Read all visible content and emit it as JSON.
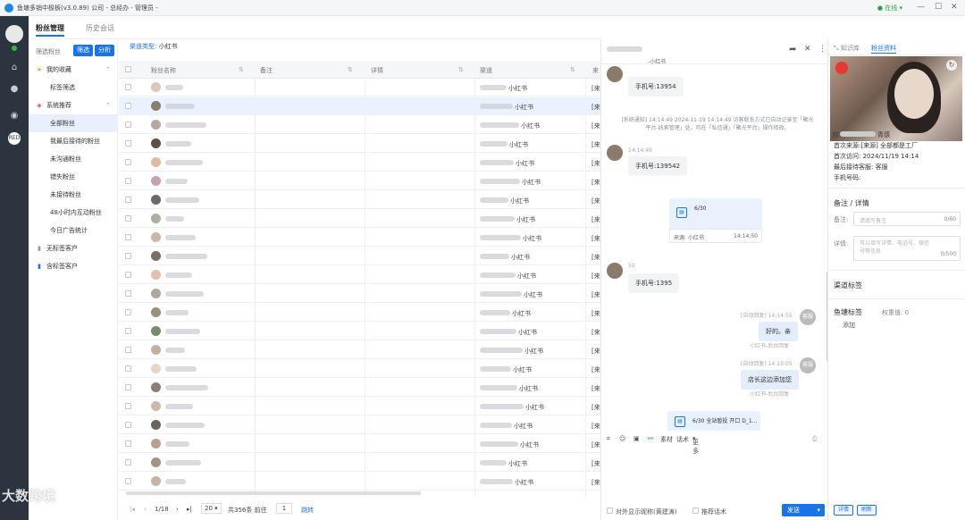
{
  "window": {
    "title": "鱼塘多销中极板(v3.0.89)    公司 - 总经办 - 管理员 -",
    "status": "在线"
  },
  "tabs": [
    "粉丝管理",
    "历史会话"
  ],
  "filter": {
    "label": "筛选粉丝",
    "btn_filter": "筛选",
    "btn_analyze": "分析"
  },
  "nav": {
    "favorites": "我的收藏",
    "tag_filter": "标签筛选",
    "system": "系统推荐",
    "all": "全部粉丝",
    "recent": "我最后接待的粉丝",
    "not_followed": "未沟通粉丝",
    "lost": "错失粉丝",
    "not_received": "未接待粉丝",
    "active48": "48小时内互动粉丝",
    "ad_stats": "今日广告统计",
    "no_tag": "无标签客户",
    "has_tag": "含标签客户"
  },
  "source_type": {
    "label": "渠道类型:",
    "value": "小红书"
  },
  "columns": [
    "粉丝名称",
    "备注",
    "详情",
    "渠道",
    "来"
  ],
  "rows": [
    {
      "channel": "小红书",
      "extra": "[来"
    },
    {
      "channel": "小红书",
      "extra": "[来"
    },
    {
      "channel": "小红书",
      "extra": "[来"
    },
    {
      "channel": "小红书",
      "extra": "[来"
    },
    {
      "channel": "小红书",
      "extra": "[来"
    },
    {
      "channel": "小红书",
      "extra": "[来"
    },
    {
      "channel": "小红书",
      "extra": "[来"
    },
    {
      "channel": "小红书",
      "extra": "[来"
    },
    {
      "channel": "小红书",
      "extra": "[来"
    },
    {
      "channel": "小红书",
      "extra": "[来"
    },
    {
      "channel": "小红书",
      "extra": "[来"
    },
    {
      "channel": "小红书",
      "extra": "[来"
    },
    {
      "channel": "小红书",
      "extra": "[来"
    },
    {
      "channel": "小红书",
      "extra": "[来"
    },
    {
      "channel": "小红书",
      "extra": "[来"
    },
    {
      "channel": "小红书",
      "extra": "[来"
    },
    {
      "channel": "小红书",
      "extra": "[来"
    },
    {
      "channel": "小红书",
      "extra": "[来"
    },
    {
      "channel": "小红书",
      "extra": "[来"
    },
    {
      "channel": "小红书",
      "extra": "[来"
    },
    {
      "channel": "小红书",
      "extra": "[来"
    },
    {
      "channel": "小红书",
      "extra": "[来"
    }
  ],
  "pager": {
    "page": "1/18",
    "size": "20",
    "total": "共356条 前往",
    "goto": "1",
    "jump": "跳转"
  },
  "chat": {
    "header_sub": "-小红书",
    "m1": "手机号:13954",
    "sys": "[系统通知] 14:14:49 2024-11-19 14:14:49 访客联系方式已自动记录至「聚光平台-线索管理」处。可在「私信通」「聚光平台」操作修改。",
    "t2": "14:14:49",
    "m2": "手机号:139542",
    "card_title": "6/30",
    "card_src": "来源: 小红书",
    "card_time": "14:14:50",
    "t3": "50",
    "m3": "手机号:1395",
    "auto1": "[自动回复] 14:14:55",
    "r1": "好的。亲",
    "rfrom1": "小红书-后台回复",
    "ravname": "客服",
    "auto2": "[自动回复] 14:15:05",
    "r2": "店长这边添加您",
    "rfrom2": "小红书-后台回复",
    "card2_title": "6/30 全站暂投 开口 D_1...",
    "tools": [
      "素材",
      "话术",
      "更多"
    ],
    "opt1": "对外显示昵称(黄建涛)",
    "opt2": "推荐话术",
    "send": "发送"
  },
  "profile": {
    "tabs": [
      "知识库",
      "粉丝资料"
    ],
    "name_tail": "青感",
    "first_src_label": "首次来源:",
    "first_src": "[来源]     全部都是工厂",
    "first_visit_label": "首次访问:",
    "first_visit": "2024/11/19 14:14",
    "last_agent_label": "最后接待客服:",
    "last_agent": "客服",
    "phone_label": "手机号码:",
    "notes_title": "备注 / 详情",
    "note_label": "备注:",
    "note_ph": "请填写备注",
    "note_cnt": "0/60",
    "detail_label": "详情:",
    "detail_ph": "可以填写详情、电话号、微信号等信息",
    "detail_cnt": "0/500",
    "channel_tags": "渠道标签",
    "fish_tags": "鱼塘标签",
    "weight": "权重值: 0",
    "add": "添加",
    "btn_detail": "详情",
    "btn_refresh": "刷新"
  },
  "watermark": "大数跨境"
}
